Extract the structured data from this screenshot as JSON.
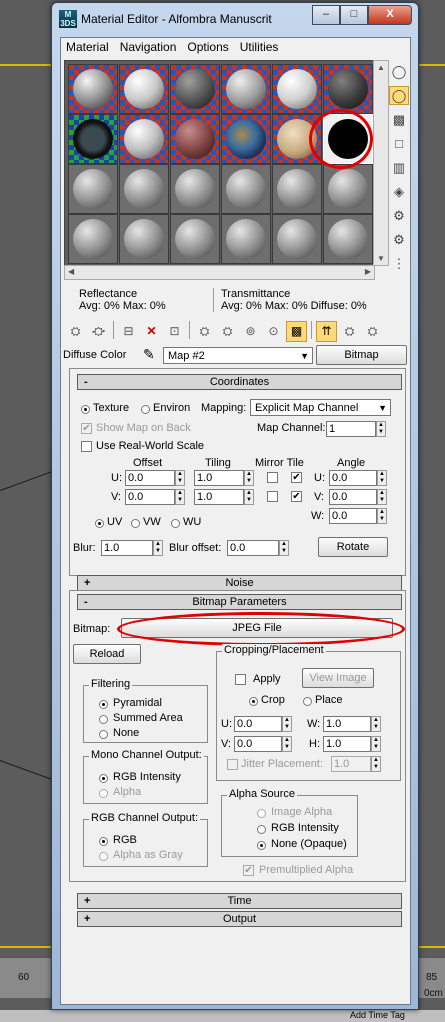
{
  "window": {
    "title": "Material Editor - Alfombra Manuscrit",
    "icon_label": "M 3DS",
    "minimize": "–",
    "maximize": "□",
    "close": "X"
  },
  "menu": [
    "Material",
    "Navigation",
    "Options",
    "Utilities"
  ],
  "info": {
    "reflectance_title": "Reflectance",
    "reflectance_values": "Avg:   0% Max:   0%",
    "transmittance_title": "Transmittance",
    "transmittance_values": "Avg:   0% Max:   0% Diffuse:   0%"
  },
  "diffuse": {
    "label": "Diffuse Color",
    "map_name": "Map #2",
    "map_type_button": "Bitmap"
  },
  "coordinates": {
    "header": "Coordinates",
    "texture": "Texture",
    "environ": "Environ",
    "mapping_label": "Mapping:",
    "mapping_value": "Explicit Map Channel",
    "show_map_on_back": "Show Map on Back",
    "map_channel_label": "Map Channel:",
    "map_channel_value": "1",
    "use_real_world": "Use Real-World Scale",
    "offset_label": "Offset",
    "tiling_label": "Tiling",
    "mirror_tile_label": "Mirror Tile",
    "angle_label": "Angle",
    "u_label": "U:",
    "v_label": "V:",
    "w_label": "W:",
    "u_offset": "0.0",
    "v_offset": "0.0",
    "u_tiling": "1.0",
    "v_tiling": "1.0",
    "u_angle": "0.0",
    "v_angle": "0.0",
    "w_angle": "0.0",
    "uv": "UV",
    "vw": "VW",
    "wu": "WU",
    "blur_label": "Blur:",
    "blur_value": "1.0",
    "blur_offset_label": "Blur offset:",
    "blur_offset_value": "0.0",
    "rotate_button": "Rotate"
  },
  "noise": {
    "header": "Noise"
  },
  "bitmap_params": {
    "header": "Bitmap Parameters",
    "bitmap_label": "Bitmap:",
    "bitmap_file": "JPEG File",
    "reload": "Reload",
    "cropping_title": "Cropping/Placement",
    "apply": "Apply",
    "view_image": "View Image",
    "crop": "Crop",
    "place": "Place",
    "u_label": "U:",
    "v_label": "V:",
    "w_label": "W:",
    "h_label": "H:",
    "u_value": "0.0",
    "v_value": "0.0",
    "w_value": "1.0",
    "h_value": "1.0",
    "jitter_label": "Jitter Placement:",
    "jitter_value": "1.0",
    "filtering_title": "Filtering",
    "pyramidal": "Pyramidal",
    "summed_area": "Summed Area",
    "none": "None",
    "mono_title": "Mono Channel Output:",
    "rgb_intensity": "RGB Intensity",
    "alpha": "Alpha",
    "rgb_channel_title": "RGB Channel Output:",
    "rgb": "RGB",
    "alpha_as_gray": "Alpha as Gray",
    "alpha_source_title": "Alpha Source",
    "image_alpha": "Image Alpha",
    "alpha_rgb_intensity": "RGB Intensity",
    "none_opaque": "None (Opaque)",
    "premultiplied": "Premultiplied Alpha"
  },
  "time": {
    "header": "Time"
  },
  "output": {
    "header": "Output"
  },
  "viewport": {
    "ruler_left": "60",
    "ruler_right": "85",
    "status_right": "0cm",
    "status_bottom": "Add Time Tag"
  },
  "colors": {
    "annotation_red": "#e10000",
    "active_tool": "#ffd97a"
  }
}
